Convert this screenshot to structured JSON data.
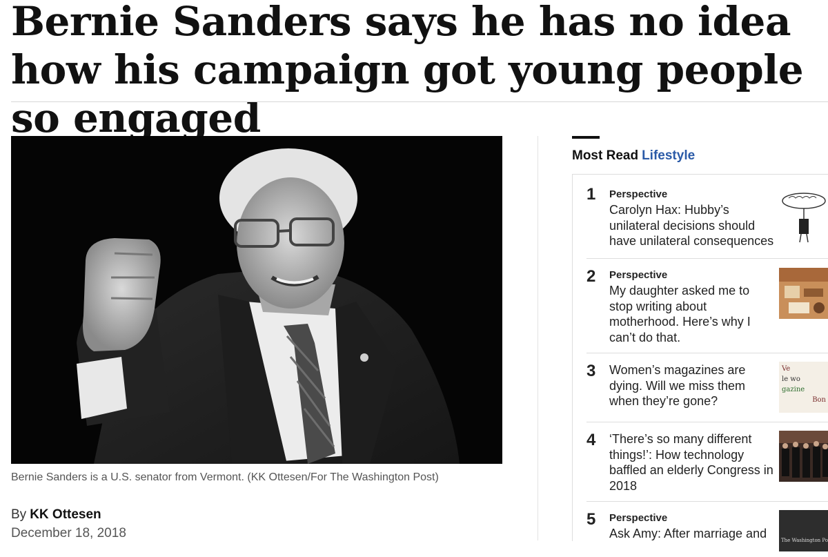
{
  "article": {
    "headline": "Bernie Sanders says he has no idea how his campaign got young people so engaged",
    "photo_caption": "Bernie Sanders is a U.S. senator from Vermont. (KK Ottesen/For The Washington Post)",
    "byline_prefix": "By",
    "author": "KK Ottesen",
    "date": "December 18, 2018"
  },
  "most_read": {
    "title": "Most Read",
    "section": "Lifestyle",
    "items": [
      {
        "rank": "1",
        "label": "Perspective",
        "headline": "Carolyn Hax: Hubby’s unilateral decisions should have unilateral consequences",
        "thumb": "cartoon-figure"
      },
      {
        "rank": "2",
        "label": "Perspective",
        "headline": "My daughter asked me to stop writing about motherhood. Here’s why I can’t do that.",
        "thumb": "craft-desk"
      },
      {
        "rank": "3",
        "label": "",
        "headline": "Women’s magazines are dying. Will we miss them when they’re gone?",
        "thumb_lines": [
          "Ve ",
          "le wo",
          "gazine",
          "Bon"
        ]
      },
      {
        "rank": "4",
        "label": "",
        "headline": "‘There’s so many different things!’: How technology baffled an elderly Congress in 2018",
        "thumb": "congress-hearing"
      },
      {
        "rank": "5",
        "label": "Perspective",
        "headline": "Ask Amy: After marriage and",
        "thumb_text": "The Washington Post"
      }
    ]
  }
}
